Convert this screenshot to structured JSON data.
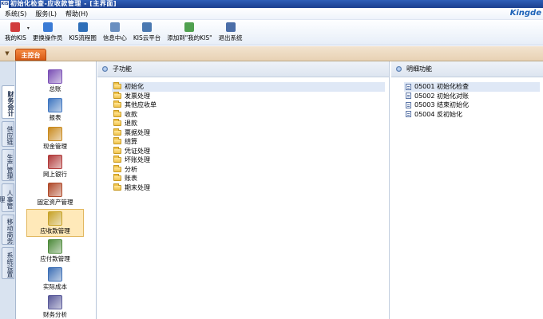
{
  "window": {
    "title": "初始化检查-应收款管理 - [主界面]",
    "icon_text": "KIS"
  },
  "menu": [
    "系统(S)",
    "服务(L)",
    "帮助(H)"
  ],
  "brand": "Kingde",
  "toolbar": [
    {
      "label": "我的KIS",
      "icon": "star-icon",
      "color": "#d23c3c",
      "has_dropdown": true
    },
    {
      "label": "更换操作员",
      "icon": "user-swap-icon",
      "color": "#3a7bd5"
    },
    {
      "label": "KIS流程图",
      "icon": "flowchart-icon",
      "color": "#2f6fb8"
    },
    {
      "label": "信息中心",
      "icon": "message-icon",
      "color": "#6a8fc0"
    },
    {
      "label": "KIS云平台",
      "icon": "cloud-icon",
      "color": "#4a78b0"
    },
    {
      "label": "添加到\"我的KIS\"",
      "icon": "add-favorite-icon",
      "color": "#4fa04f"
    },
    {
      "label": "退出系统",
      "icon": "exit-icon",
      "color": "#4b6ea8"
    }
  ],
  "workspace_tab": "主控台",
  "side_tabs": [
    {
      "label": "财务会计",
      "active": true
    },
    {
      "label": "供应链",
      "active": false
    },
    {
      "label": "生产管理",
      "active": false
    },
    {
      "label": "人事管理",
      "active": false
    },
    {
      "label": "移动商务",
      "active": false
    },
    {
      "label": "系统设置",
      "active": false
    }
  ],
  "modules": [
    {
      "label": "总账",
      "icon": "ledger-books-icon",
      "color": "#7a4fb5"
    },
    {
      "label": "报表",
      "icon": "report-icon",
      "color": "#3f76c0"
    },
    {
      "label": "现金管理",
      "icon": "cash-icon",
      "color": "#c98a1e"
    },
    {
      "label": "网上银行",
      "icon": "online-bank-icon",
      "color": "#b13a3a"
    },
    {
      "label": "固定资产管理",
      "icon": "fixed-asset-truck-icon",
      "color": "#b04a2a"
    },
    {
      "label": "应收款管理",
      "icon": "receivable-moneybag-icon",
      "color": "#c7a227",
      "selected": true
    },
    {
      "label": "应付款管理",
      "icon": "payable-icon",
      "color": "#4e8a3b"
    },
    {
      "label": "实际成本",
      "icon": "actual-cost-icon",
      "color": "#3d6fb5"
    },
    {
      "label": "财务分析",
      "icon": "financial-analysis-icon",
      "color": "#5a5a9a"
    }
  ],
  "sub_panel": {
    "title": "子功能",
    "items": [
      {
        "label": "初始化",
        "selected": true
      },
      {
        "label": "发票处理"
      },
      {
        "label": "其他应收单"
      },
      {
        "label": "收款"
      },
      {
        "label": "退款"
      },
      {
        "label": "票据处理"
      },
      {
        "label": "结算"
      },
      {
        "label": "凭证处理"
      },
      {
        "label": "坏账处理"
      },
      {
        "label": "分析"
      },
      {
        "label": "账表"
      },
      {
        "label": "期末处理"
      }
    ]
  },
  "detail_panel": {
    "title": "明细功能",
    "items": [
      {
        "code": "05001",
        "label": "初始化检查",
        "selected": true
      },
      {
        "code": "05002",
        "label": "初始化对账"
      },
      {
        "code": "05003",
        "label": "结束初始化"
      },
      {
        "code": "05004",
        "label": "反初始化"
      }
    ]
  }
}
